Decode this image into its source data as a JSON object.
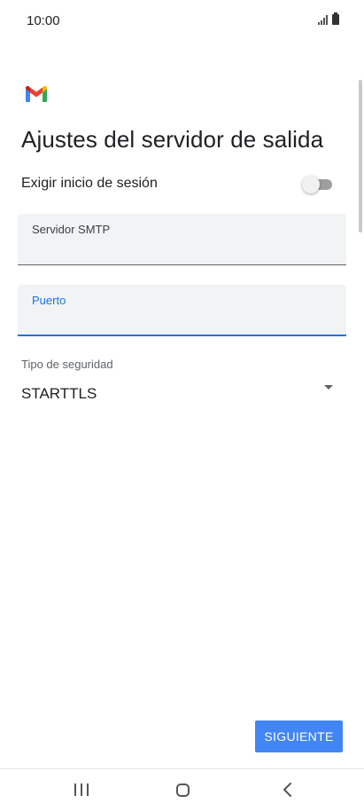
{
  "status_bar": {
    "time": "10:00"
  },
  "header": {
    "logo_icon": "gmail-logo-icon",
    "title": "Ajustes del servidor de salida"
  },
  "signin_toggle": {
    "label": "Exigir inicio de sesión",
    "checked": false
  },
  "smtp_field": {
    "label": "Servidor SMTP",
    "value": ""
  },
  "port_field": {
    "label": "Puerto",
    "value": "",
    "focused": true
  },
  "security": {
    "label": "Tipo de seguridad",
    "selected": "STARTTLS"
  },
  "actions": {
    "next_label": "SIGUIENTE"
  },
  "colors": {
    "accent": "#1a73e8",
    "button": "#4285f4",
    "field_background": "#f1f3f4"
  },
  "nav_bar": {
    "icons": [
      "recents-icon",
      "home-icon",
      "back-icon"
    ]
  }
}
